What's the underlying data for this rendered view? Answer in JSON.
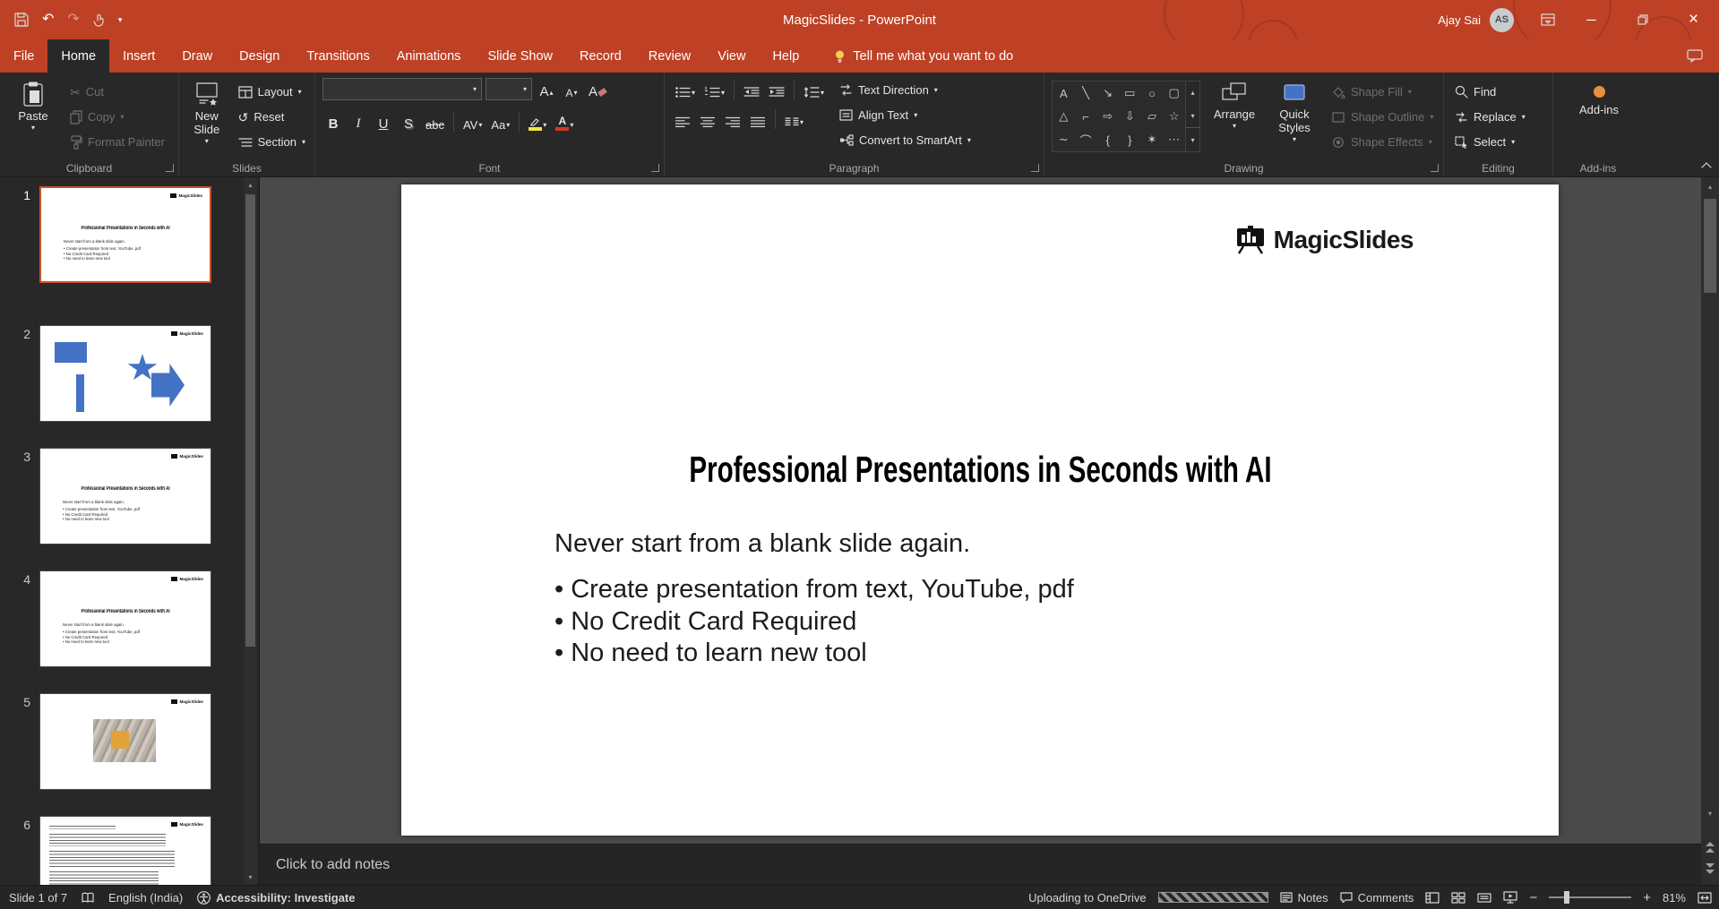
{
  "titlebar": {
    "title": "MagicSlides - PowerPoint",
    "user_name": "Ajay Sai",
    "user_initials": "AS"
  },
  "menu": {
    "tabs": [
      {
        "label": "File"
      },
      {
        "label": "Home"
      },
      {
        "label": "Insert"
      },
      {
        "label": "Draw"
      },
      {
        "label": "Design"
      },
      {
        "label": "Transitions"
      },
      {
        "label": "Animations"
      },
      {
        "label": "Slide Show"
      },
      {
        "label": "Record"
      },
      {
        "label": "Review"
      },
      {
        "label": "View"
      },
      {
        "label": "Help"
      }
    ],
    "selected_tab": "Home",
    "tell_me": "Tell me what you want to do"
  },
  "ribbon": {
    "clipboard": {
      "label": "Clipboard",
      "paste": "Paste",
      "cut": "Cut",
      "copy": "Copy",
      "format_painter": "Format Painter"
    },
    "slides": {
      "label": "Slides",
      "new_slide": "New Slide",
      "layout": "Layout",
      "reset": "Reset",
      "section": "Section"
    },
    "font": {
      "label": "Font",
      "font_name_value": "",
      "font_size_value": "",
      "bold": "B",
      "italic": "I",
      "underline": "U",
      "shadow": "S",
      "strikethrough": "abc",
      "char_spacing": "AV",
      "change_case": "Aa",
      "font_color_letter": "A"
    },
    "paragraph": {
      "label": "Paragraph",
      "text_direction": "Text Direction",
      "align_text": "Align Text",
      "convert_smartart": "Convert to SmartArt"
    },
    "drawing": {
      "label": "Drawing",
      "arrange": "Arrange",
      "quick_styles": "Quick Styles",
      "shape_fill": "Shape Fill",
      "shape_outline": "Shape Outline",
      "shape_effects": "Shape Effects",
      "shape_glyphs_row1": [
        "A",
        "╲",
        "↘",
        "▭",
        "○",
        "▢"
      ],
      "shape_glyphs_row2": [
        "△",
        "⌐",
        "⇨",
        "⇩",
        "▱",
        "☆"
      ],
      "shape_glyphs_row3": [
        "∼",
        "⌒",
        "{",
        "}",
        "✶",
        "⋯"
      ]
    },
    "editing": {
      "label": "Editing",
      "find": "Find",
      "replace": "Replace",
      "select": "Select"
    },
    "addins": {
      "label": "Add-ins",
      "button": "Add-ins"
    }
  },
  "slide": {
    "logo_text": "MagicSlides",
    "title": "Professional Presentations in Seconds with AI",
    "subtitle": "Never start from a blank slide again.",
    "bullets": [
      "• Create presentation from text, YouTube, pdf",
      "• No Credit Card Required",
      "• No need to learn new tool"
    ]
  },
  "thumbnails": {
    "numbers": [
      "1",
      "2",
      "3",
      "4",
      "5",
      "6"
    ],
    "selected_number": "1"
  },
  "notes": {
    "placeholder": "Click to add notes"
  },
  "statusbar": {
    "slide_indicator": "Slide 1 of 7",
    "language": "English (India)",
    "accessibility": "Accessibility: Investigate",
    "upload": "Uploading to OneDrive",
    "notes_label": "Notes",
    "comments_label": "Comments",
    "zoom_level": "81%"
  },
  "icons": {
    "chevron_down": "▾",
    "chevron_up": "▴",
    "scissors": "✂",
    "undo": "↶",
    "redo": "↷",
    "reset": "↺",
    "minimize": "─",
    "close": "×",
    "letter_a": "A",
    "minus": "−",
    "plus": "+"
  },
  "colors": {
    "titlebar_red": "#BE4125",
    "selection_border": "#C9512C",
    "shape_blue": "#4472C4",
    "addin_orange": "#E8913A"
  }
}
